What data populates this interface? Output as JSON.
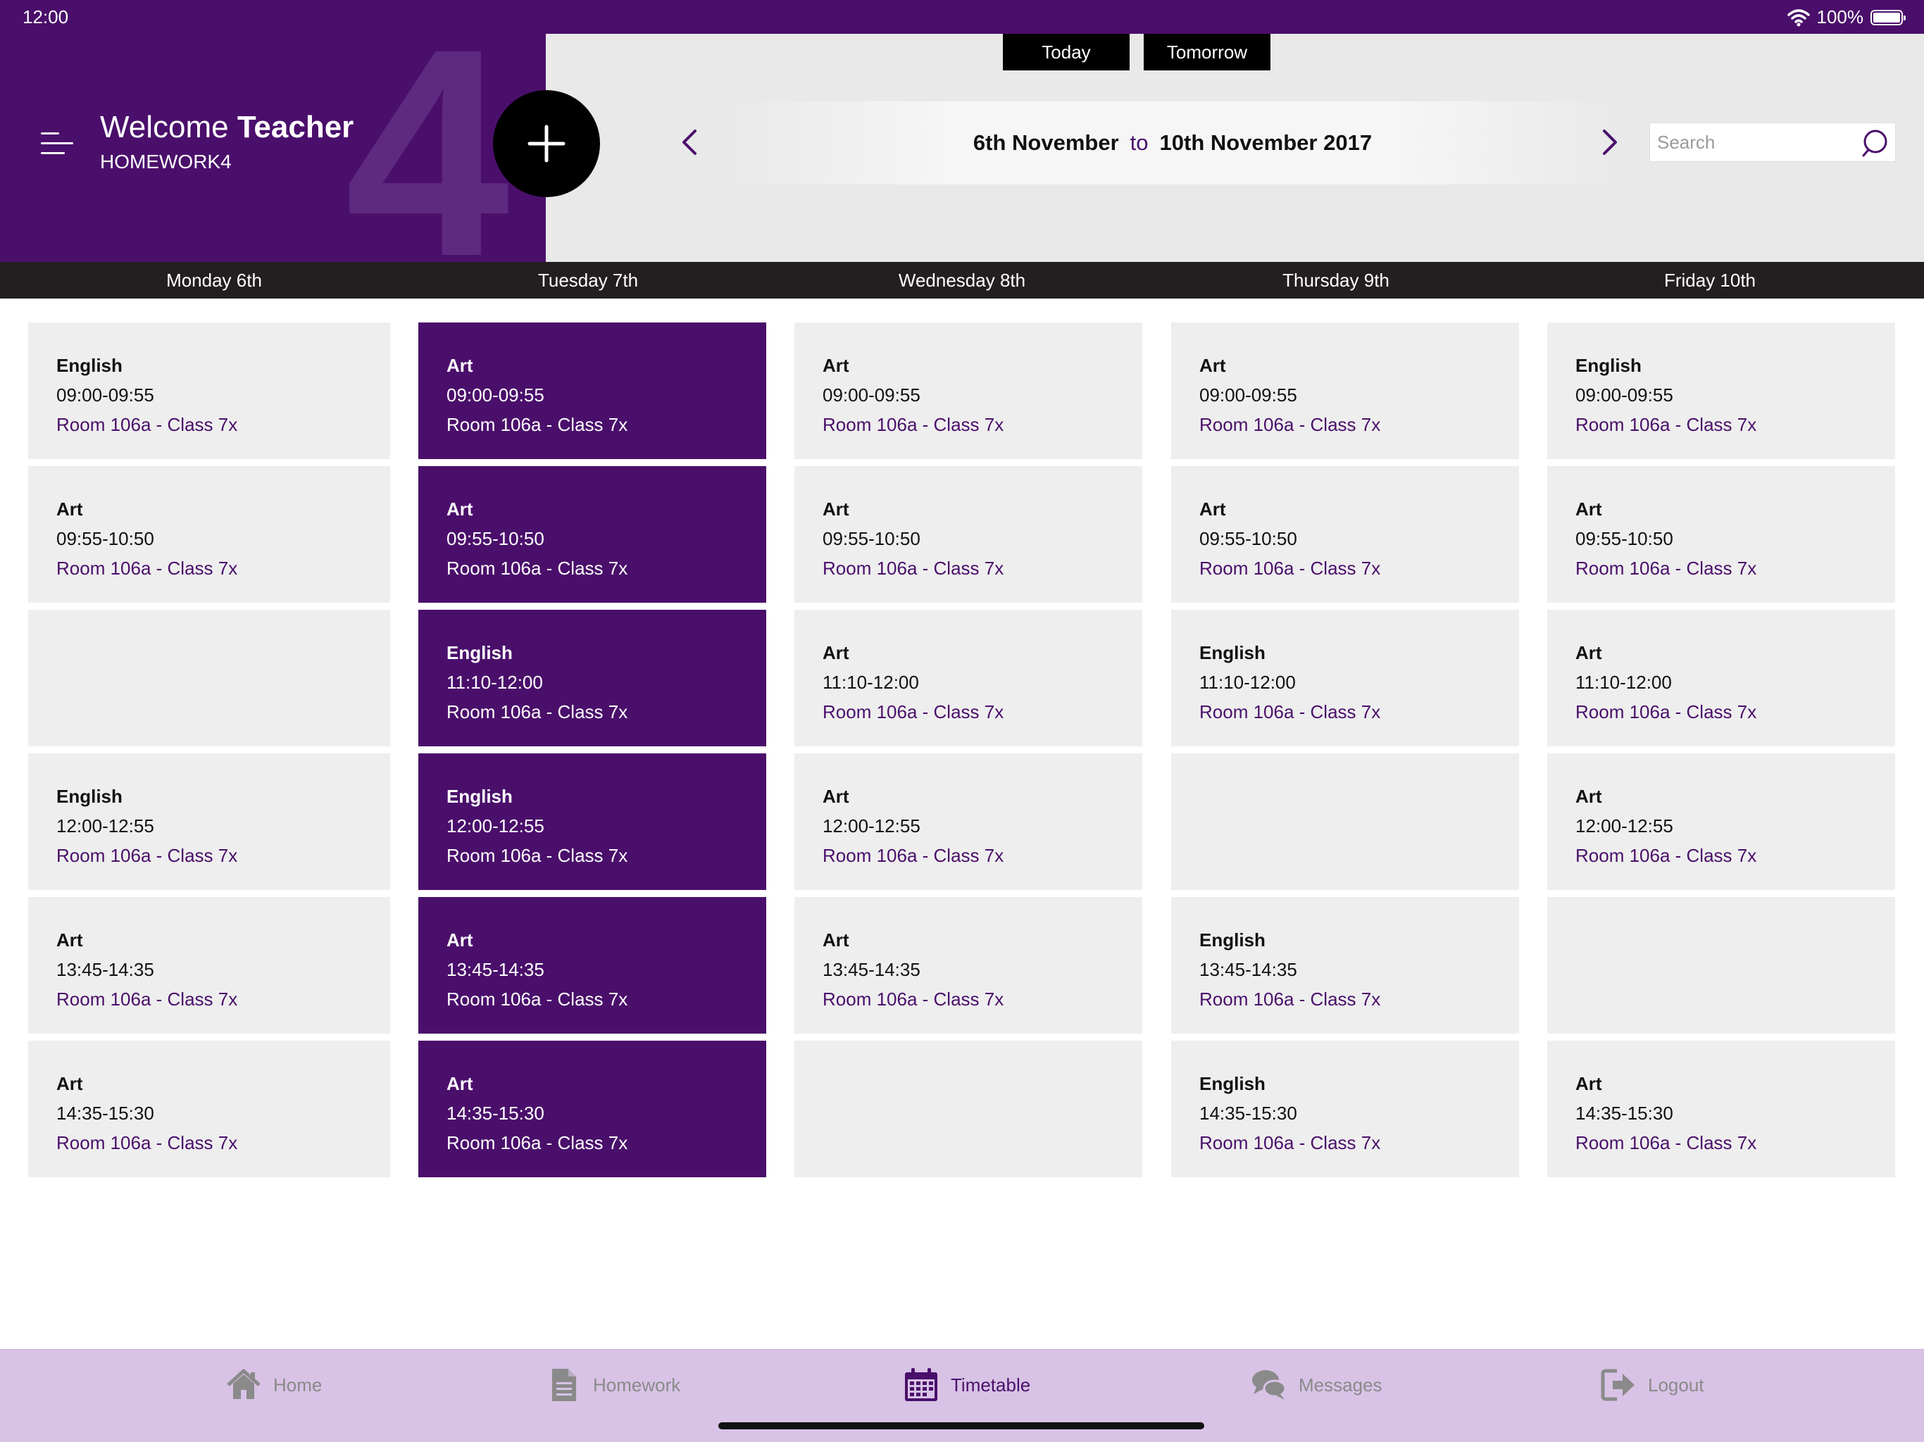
{
  "status_bar": {
    "time": "12:00",
    "battery": "100%"
  },
  "header": {
    "welcome_prefix": "Welcome",
    "welcome_name": "Teacher",
    "subtitle": "HOMEWORK4",
    "big_numeral": "4"
  },
  "quick_nav": {
    "today_label": "Today",
    "tomorrow_label": "Tomorrow"
  },
  "date_range": {
    "start": "6th November",
    "connector": "to",
    "end": "10th November 2017"
  },
  "search": {
    "placeholder": "Search"
  },
  "days": [
    {
      "label": "Monday 6th",
      "highlighted": false,
      "slots": [
        {
          "subject": "English",
          "time": "09:00-09:55",
          "room": "Room 106a - Class 7x"
        },
        {
          "subject": "Art",
          "time": "09:55-10:50",
          "room": "Room 106a - Class 7x"
        },
        null,
        {
          "subject": "English",
          "time": "12:00-12:55",
          "room": "Room 106a - Class 7x"
        },
        {
          "subject": "Art",
          "time": "13:45-14:35",
          "room": "Room 106a - Class 7x"
        },
        {
          "subject": "Art",
          "time": "14:35-15:30",
          "room": "Room 106a - Class 7x"
        }
      ]
    },
    {
      "label": "Tuesday 7th",
      "highlighted": true,
      "slots": [
        {
          "subject": "Art",
          "time": "09:00-09:55",
          "room": "Room 106a - Class 7x"
        },
        {
          "subject": "Art",
          "time": "09:55-10:50",
          "room": "Room 106a - Class 7x"
        },
        {
          "subject": "English",
          "time": "11:10-12:00",
          "room": "Room 106a - Class 7x"
        },
        {
          "subject": "English",
          "time": "12:00-12:55",
          "room": "Room 106a - Class 7x"
        },
        {
          "subject": "Art",
          "time": "13:45-14:35",
          "room": "Room 106a - Class 7x"
        },
        {
          "subject": "Art",
          "time": "14:35-15:30",
          "room": "Room 106a - Class 7x"
        }
      ]
    },
    {
      "label": "Wednesday 8th",
      "highlighted": false,
      "slots": [
        {
          "subject": "Art",
          "time": "09:00-09:55",
          "room": "Room 106a - Class 7x"
        },
        {
          "subject": "Art",
          "time": "09:55-10:50",
          "room": "Room 106a - Class 7x"
        },
        {
          "subject": "Art",
          "time": "11:10-12:00",
          "room": "Room 106a - Class 7x"
        },
        {
          "subject": "Art",
          "time": "12:00-12:55",
          "room": "Room 106a - Class 7x"
        },
        {
          "subject": "Art",
          "time": "13:45-14:35",
          "room": "Room 106a - Class 7x"
        },
        null
      ]
    },
    {
      "label": "Thursday 9th",
      "highlighted": false,
      "slots": [
        {
          "subject": "Art",
          "time": "09:00-09:55",
          "room": "Room 106a - Class 7x"
        },
        {
          "subject": "Art",
          "time": "09:55-10:50",
          "room": "Room 106a - Class 7x"
        },
        {
          "subject": "English",
          "time": "11:10-12:00",
          "room": "Room 106a - Class 7x"
        },
        null,
        {
          "subject": "English",
          "time": "13:45-14:35",
          "room": "Room 106a - Class 7x"
        },
        {
          "subject": "English",
          "time": "14:35-15:30",
          "room": "Room 106a - Class 7x"
        }
      ]
    },
    {
      "label": "Friday 10th",
      "highlighted": false,
      "slots": [
        {
          "subject": "English",
          "time": "09:00-09:55",
          "room": "Room 106a - Class 7x"
        },
        {
          "subject": "Art",
          "time": "09:55-10:50",
          "room": "Room 106a - Class 7x"
        },
        {
          "subject": "Art",
          "time": "11:10-12:00",
          "room": "Room 106a - Class 7x"
        },
        {
          "subject": "Art",
          "time": "12:00-12:55",
          "room": "Room 106a - Class 7x"
        },
        null,
        {
          "subject": "Art",
          "time": "14:35-15:30",
          "room": "Room 106a - Class 7x"
        }
      ]
    }
  ],
  "tabs": [
    {
      "label": "Home",
      "icon": "home-icon",
      "active": false
    },
    {
      "label": "Homework",
      "icon": "document-icon",
      "active": false
    },
    {
      "label": "Timetable",
      "icon": "calendar-icon",
      "active": true
    },
    {
      "label": "Messages",
      "icon": "chat-icon",
      "active": false
    },
    {
      "label": "Logout",
      "icon": "logout-icon",
      "active": false
    }
  ],
  "colors": {
    "brand_purple": "#4a0f6b",
    "cell_grey": "#eeeeee",
    "day_bar": "#231f20",
    "tab_bar": "#d8c3e6"
  }
}
